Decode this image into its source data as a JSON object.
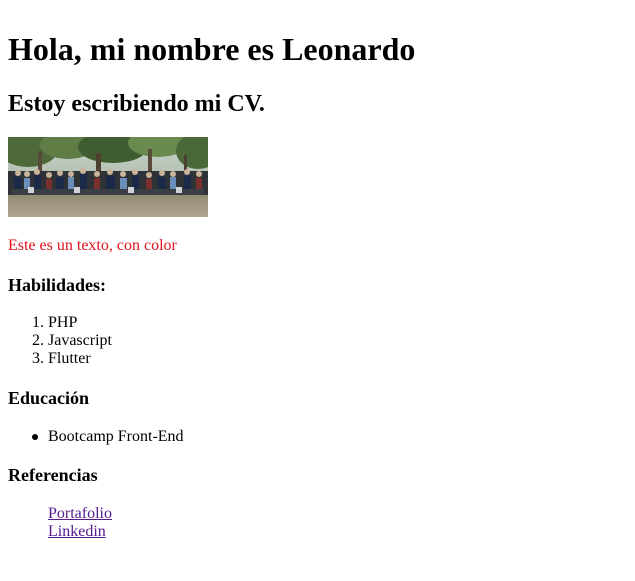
{
  "header": {
    "title": "Hola, mi nombre es Leonardo",
    "subtitle": "Estoy escribiendo mi CV."
  },
  "colors": {
    "accent_text": "#e1121c",
    "link_visited": "#551a8b",
    "link": "#0000ee"
  },
  "colored_paragraph": "Este es un texto, con color",
  "skills": {
    "heading": "Habilidades:",
    "items": [
      {
        "number": "1.",
        "label": "PHP"
      },
      {
        "number": "2.",
        "label": "Javascript"
      },
      {
        "number": "3.",
        "label": "Flutter"
      }
    ]
  },
  "education": {
    "heading": "Educación",
    "items": [
      {
        "label": "Bootcamp Front-End"
      }
    ]
  },
  "references": {
    "heading": "Referencias",
    "links": [
      {
        "label": "Portafolio"
      },
      {
        "label": "Linkedin"
      }
    ]
  }
}
